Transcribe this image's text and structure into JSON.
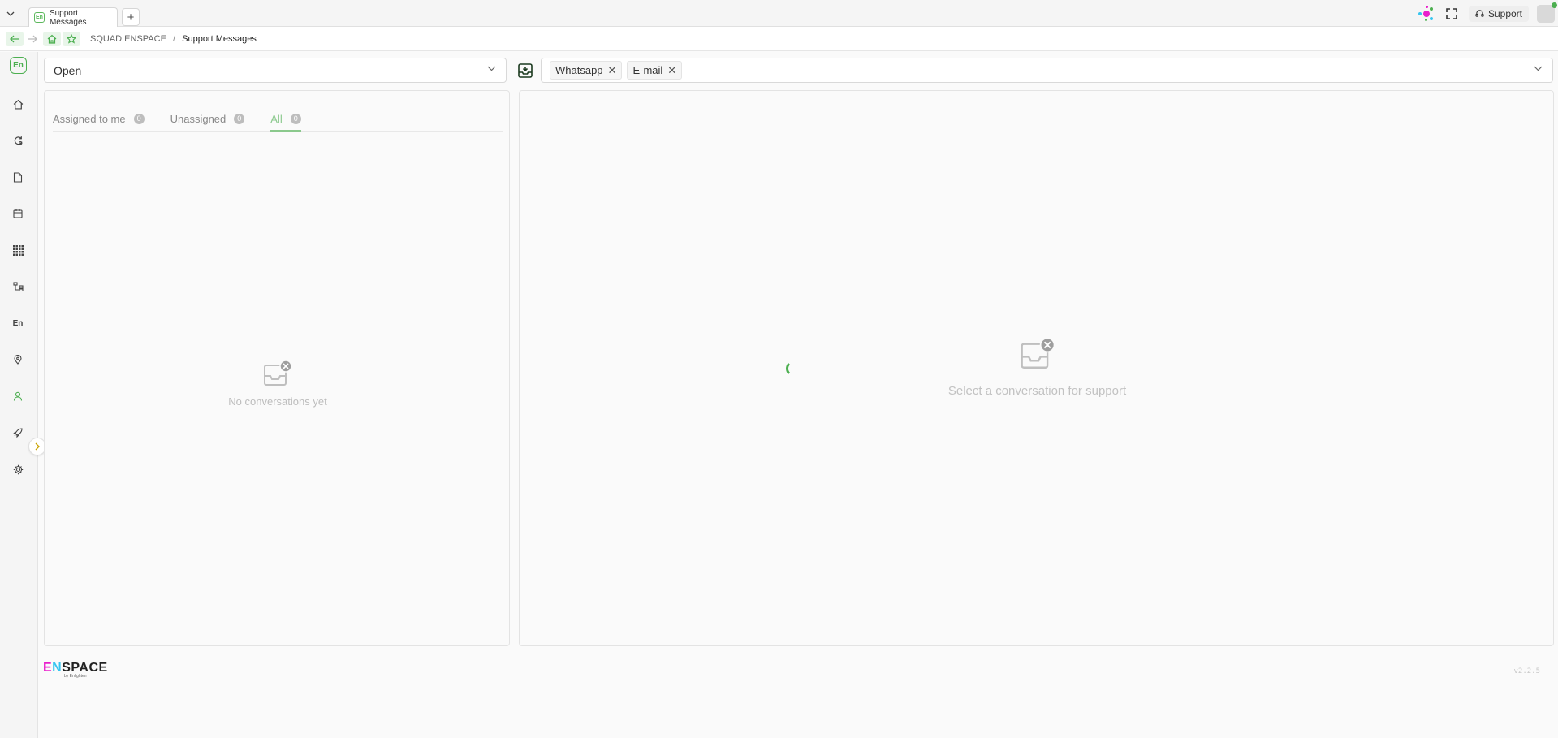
{
  "browser": {
    "tab_title": "Support Messages",
    "tab_favicon": "En",
    "new_tab": "+",
    "support_label": "Support"
  },
  "address": {
    "crumb_root": "SQUAD ENSPACE",
    "crumb_sep": "/",
    "crumb_current": "Support Messages"
  },
  "sidebar": {
    "logo": "En",
    "items": [
      {
        "icon": "home-icon"
      },
      {
        "icon": "refresh-settings-icon"
      },
      {
        "icon": "document-icon"
      },
      {
        "icon": "calendar-icon"
      },
      {
        "icon": "grid-icon"
      },
      {
        "icon": "hierarchy-icon"
      },
      {
        "icon": "en-text-icon",
        "label": "En"
      },
      {
        "icon": "location-icon"
      },
      {
        "icon": "user-icon"
      },
      {
        "icon": "rocket-icon"
      },
      {
        "icon": "gear-icon"
      }
    ]
  },
  "filters": {
    "status_value": "Open",
    "channels": [
      "Whatsapp",
      "E-mail"
    ]
  },
  "tabs": [
    {
      "label": "Assigned to me",
      "count": "0"
    },
    {
      "label": "Unassigned",
      "count": "0"
    },
    {
      "label": "All",
      "count": "0",
      "active": true
    }
  ],
  "left_empty_text": "No conversations yet",
  "right_empty_text": "Select a conversation for support",
  "footer": {
    "brand": "ENSPACE",
    "brand_by": "by Enlighten",
    "version": "v2.2.5"
  },
  "colors": {
    "accent": "#4caf50",
    "accent_light": "#8bc98d"
  }
}
